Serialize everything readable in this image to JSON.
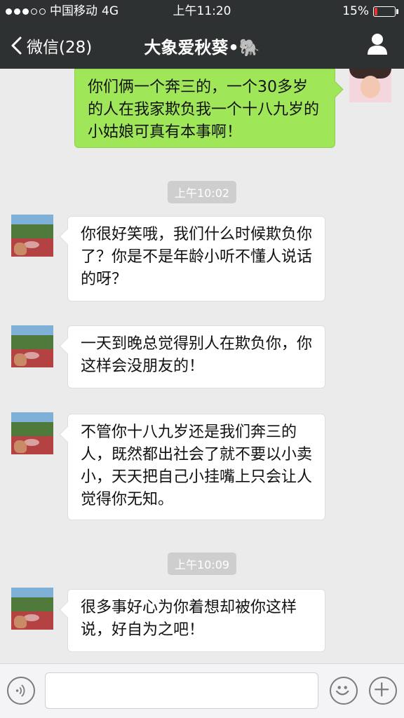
{
  "status_bar": {
    "carrier": "中国移动",
    "network": "4G",
    "time": "上午11:20",
    "battery_percent": "15%",
    "battery_level": 0.15,
    "battery_color": "#e33333"
  },
  "nav": {
    "back_label": "微信(28)",
    "title": "大象爱秋葵•🐘",
    "profile_icon": "person-icon"
  },
  "messages": [
    {
      "side": "right",
      "text": "你们俩一个奔三的，一个30多岁的人在我家欺负我一个十八九岁的小姑娘可真有本事啊！"
    },
    {
      "type": "time",
      "text": "上午10:02"
    },
    {
      "side": "left",
      "text": "你很好笑哦，我们什么时候欺负你了？你是不是年龄小听不懂人说话的呀？"
    },
    {
      "side": "left",
      "text": "一天到晚总觉得别人在欺负你，你这样会没朋友的！"
    },
    {
      "side": "left",
      "text": "不管你十八九岁还是我们奔三的人，既然都出社会了就不要以小卖小，天天把自己小挂嘴上只会让人觉得你无知。"
    },
    {
      "type": "time",
      "text": "上午10:09"
    },
    {
      "side": "left",
      "text": "很多事好心为你着想却被你这样说，好自为之吧！"
    }
  ],
  "input_bar": {
    "voice_icon": "voice-icon",
    "emoji_icon": "emoji-icon",
    "plus_icon": "plus-icon",
    "value": ""
  },
  "colors": {
    "header_bg": "#2e3132",
    "chat_bg": "#ebebeb",
    "sent_bubble": "#9fe658",
    "received_bubble": "#ffffff"
  }
}
